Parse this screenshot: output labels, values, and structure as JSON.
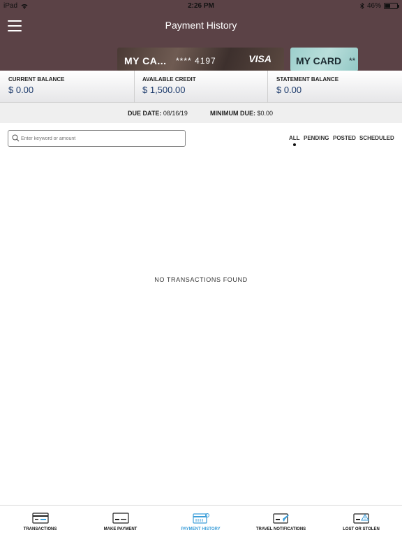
{
  "status_bar": {
    "device": "iPad",
    "time": "2:26 PM",
    "battery": "46%",
    "battery_level": 0.46,
    "icons": [
      "wifi-icon",
      "bluetooth-icon",
      "battery-icon"
    ]
  },
  "header": {
    "title": "Payment History",
    "menu_icon": "hamburger-menu-icon"
  },
  "cards": [
    {
      "name": "MY CA...",
      "number": "**** 4197",
      "brand": "VISA"
    },
    {
      "name": "MY CARD",
      "number": "**"
    }
  ],
  "balances": [
    {
      "label": "CURRENT BALANCE",
      "value": "$ 0.00"
    },
    {
      "label": "AVAILABLE CREDIT",
      "value": "$ 1,500.00"
    },
    {
      "label": "STATEMENT BALANCE",
      "value": "$ 0.00"
    }
  ],
  "due": {
    "due_date_label": "DUE DATE:",
    "due_date_value": "08/16/19",
    "min_due_label": "MINIMUM DUE:",
    "min_due_value": "$0.00"
  },
  "search": {
    "placeholder": "Enter keyword or amount",
    "value": "",
    "icon": "search-icon"
  },
  "filters": [
    {
      "label": "ALL",
      "selected": true
    },
    {
      "label": "PENDING",
      "selected": false
    },
    {
      "label": "POSTED",
      "selected": false
    },
    {
      "label": "SCHEDULED",
      "selected": false
    }
  ],
  "empty_message": "NO TRANSACTIONS FOUND",
  "tabs": [
    {
      "label": "TRANSACTIONS",
      "icon": "transactions-icon",
      "active": false
    },
    {
      "label": "MAKE PAYMENT",
      "icon": "make-payment-icon",
      "active": false
    },
    {
      "label": "PAYMENT HISTORY",
      "icon": "payment-history-icon",
      "active": true
    },
    {
      "label": "TRAVEL NOTIFICATIONS",
      "icon": "travel-notifications-icon",
      "active": false
    },
    {
      "label": "LOST OR STOLEN",
      "icon": "lost-or-stolen-icon",
      "active": false
    }
  ],
  "colors": {
    "header_bg": "#5b4246",
    "accent": "#3c9ed9",
    "balance_value": "#1c3a6b"
  }
}
